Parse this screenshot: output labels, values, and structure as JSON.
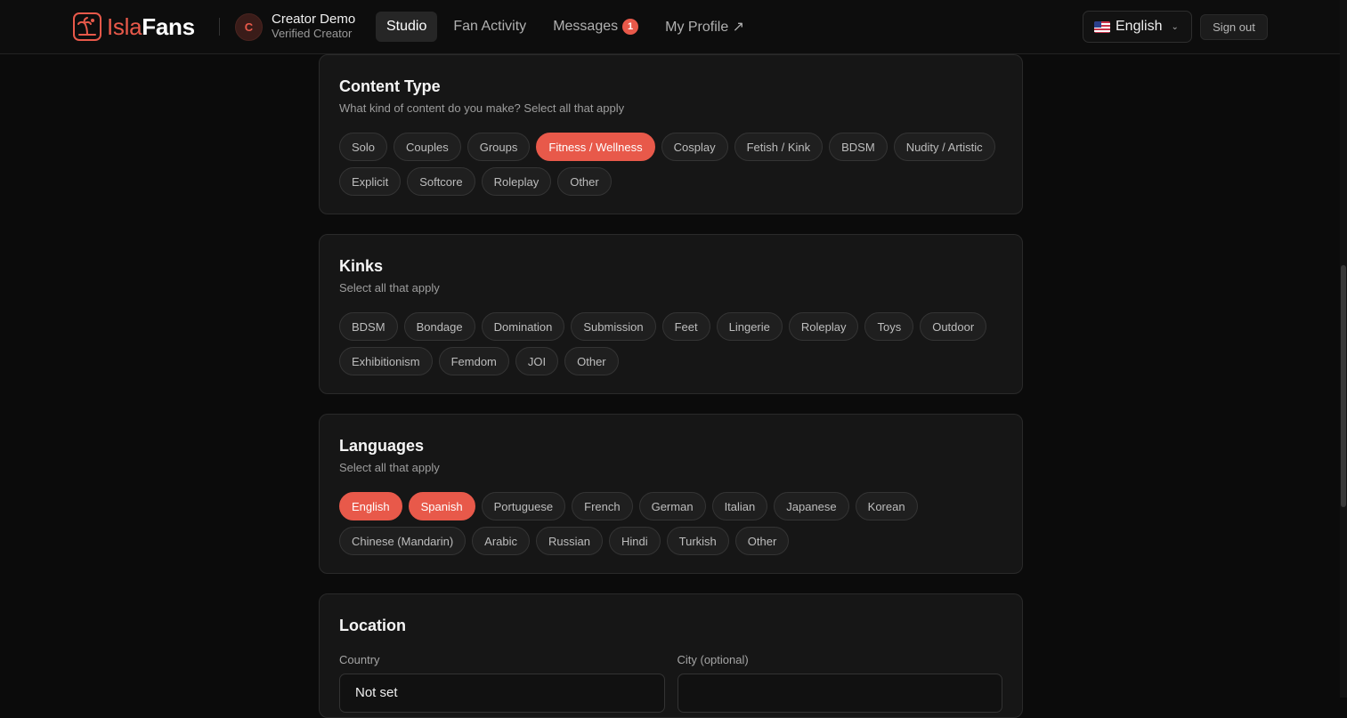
{
  "brand": {
    "name_part1": "Isla",
    "name_part2": "Fans",
    "accent": "#e8594a"
  },
  "user": {
    "initial": "C",
    "name": "Creator Demo",
    "role": "Verified Creator"
  },
  "nav": {
    "studio": "Studio",
    "fan_activity": "Fan Activity",
    "messages": "Messages",
    "messages_count": "1",
    "my_profile": "My Profile ↗"
  },
  "language_selector": {
    "selected": "English"
  },
  "sign_out": "Sign out",
  "content_type": {
    "title": "Content Type",
    "subtitle": "What kind of content do you make? Select all that apply",
    "options": [
      "Solo",
      "Couples",
      "Groups",
      "Fitness / Wellness",
      "Cosplay",
      "Fetish / Kink",
      "BDSM",
      "Nudity / Artistic",
      "Explicit",
      "Softcore",
      "Roleplay",
      "Other"
    ],
    "selected": [
      "Fitness / Wellness"
    ]
  },
  "kinks": {
    "title": "Kinks",
    "subtitle": "Select all that apply",
    "options": [
      "BDSM",
      "Bondage",
      "Domination",
      "Submission",
      "Feet",
      "Lingerie",
      "Roleplay",
      "Toys",
      "Outdoor",
      "Exhibitionism",
      "Femdom",
      "JOI",
      "Other"
    ],
    "selected": []
  },
  "languages": {
    "title": "Languages",
    "subtitle": "Select all that apply",
    "options": [
      "English",
      "Spanish",
      "Portuguese",
      "French",
      "German",
      "Italian",
      "Japanese",
      "Korean",
      "Chinese (Mandarin)",
      "Arabic",
      "Russian",
      "Hindi",
      "Turkish",
      "Other"
    ],
    "selected": [
      "English",
      "Spanish"
    ]
  },
  "location": {
    "title": "Location",
    "country_label": "Country",
    "country_value": "Not set",
    "city_label": "City (optional)",
    "city_value": ""
  }
}
